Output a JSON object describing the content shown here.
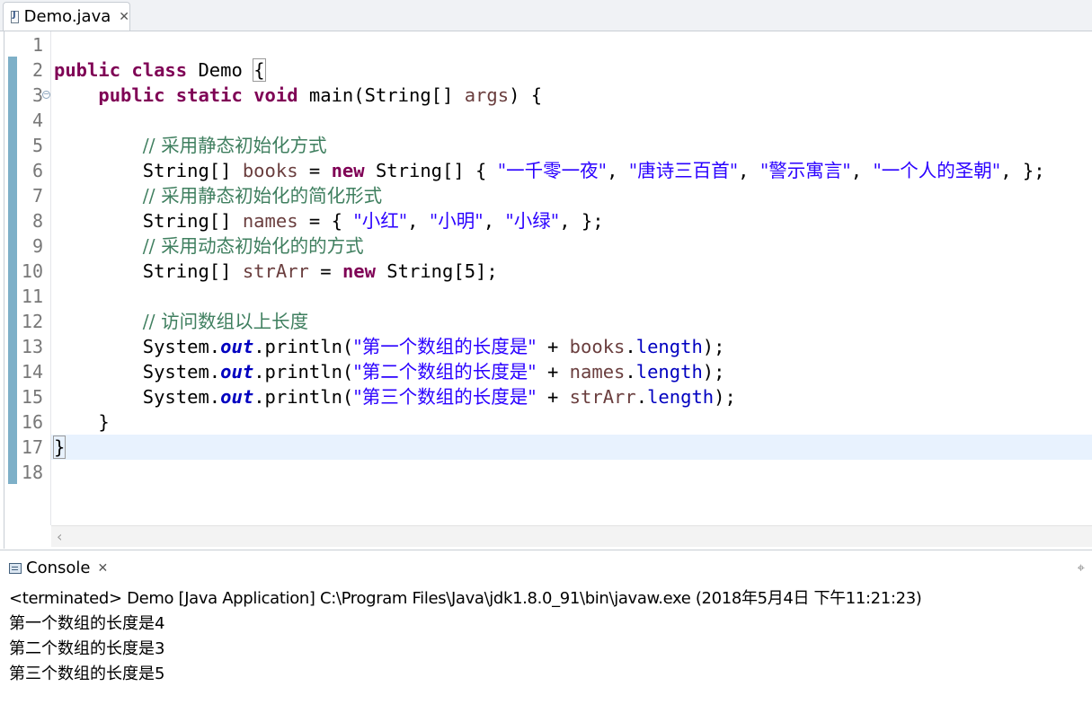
{
  "editor": {
    "tab_label": "Demo.java",
    "lines": [
      {
        "num": "1"
      },
      {
        "num": "2"
      },
      {
        "num": "3"
      },
      {
        "num": "4"
      },
      {
        "num": "5",
        "comment": "// 采用静态初始化方式"
      },
      {
        "num": "6",
        "kw": "new",
        "var": "books",
        "strings": [
          "\"一千零一夜\"",
          "\"唐诗三百首\"",
          "\"警示寓言\"",
          "\"一个人的圣朝\""
        ]
      },
      {
        "num": "7",
        "comment": "// 采用静态初始化的简化形式"
      },
      {
        "num": "8",
        "var": "names",
        "strings": [
          "\"小红\"",
          "\"小明\"",
          "\"小绿\""
        ]
      },
      {
        "num": "9",
        "comment": "// 采用动态初始化的的方式"
      },
      {
        "num": "10",
        "var": "strArr"
      },
      {
        "num": "11"
      },
      {
        "num": "12",
        "comment": "// 访问数组以上长度"
      },
      {
        "num": "13",
        "string": "\"第一个数组的长度是\"",
        "var": "books"
      },
      {
        "num": "14",
        "string": "\"第二个数组的长度是\"",
        "var": "names"
      },
      {
        "num": "15",
        "string": "\"第三个数组的长度是\"",
        "var": "strArr"
      },
      {
        "num": "16"
      },
      {
        "num": "17"
      },
      {
        "num": "18"
      }
    ],
    "tokens": {
      "public": "public",
      "class": "class",
      "static": "static",
      "void": "void",
      "class_name": "Demo",
      "main_sig": "main(String[] ",
      "args": "args",
      "type_arr": "String[] ",
      "new_arr_tail": " String[] { ",
      "brace_open": "{",
      "brace_close": "}",
      "sep": ", ",
      "end_list": ", };",
      "system": "System.",
      "out": "out",
      "println": ".println(",
      "plus": " + ",
      "dot": ".",
      "length": "length",
      "close_call": ");",
      "str5": " String[5];",
      "eq": " = ",
      "eq_brace": " = { "
    }
  },
  "console": {
    "tab_label": "Console",
    "status": "<terminated> Demo [Java Application] C:\\Program Files\\Java\\jdk1.8.0_91\\bin\\javaw.exe (2018年5月4日 下午11:21:23)",
    "output": [
      "第一个数组的长度是4",
      "第二个数组的长度是3",
      "第三个数组的长度是5"
    ]
  }
}
